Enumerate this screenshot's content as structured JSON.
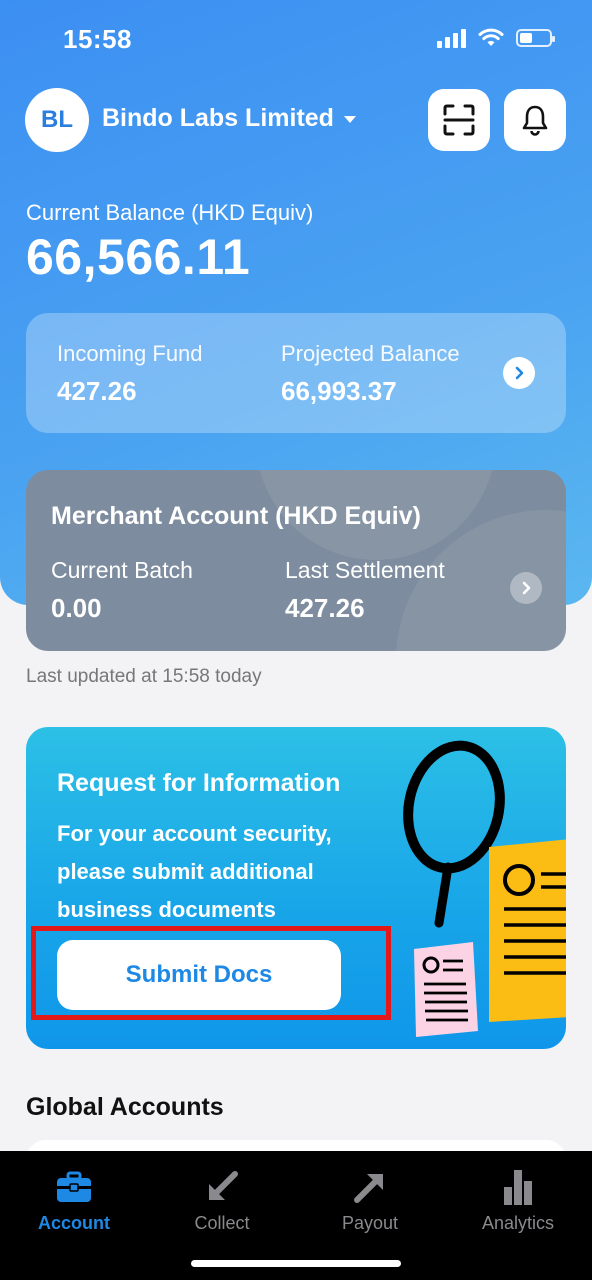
{
  "status_bar": {
    "time": "15:58"
  },
  "header": {
    "avatar_initials": "BL",
    "company_name": "Bindo Labs Limited",
    "icons": [
      "scan-icon",
      "bell-icon"
    ]
  },
  "balance": {
    "label": "Current Balance (HKD Equiv)",
    "value": "66,566.11"
  },
  "fund_card": {
    "incoming_label": "Incoming Fund",
    "incoming_value": "427.26",
    "projected_label": "Projected Balance",
    "projected_value": "66,993.37"
  },
  "merchant": {
    "title": "Merchant Account (HKD Equiv)",
    "batch_label": "Current Batch",
    "batch_value": "0.00",
    "settlement_label": "Last Settlement",
    "settlement_value": "427.26"
  },
  "last_updated": "Last updated at 15:58 today",
  "rfi": {
    "title": "Request for Information",
    "body_line1": "For your account security,",
    "body_line2": "please submit additional",
    "body_line3": "business documents",
    "button": "Submit Docs"
  },
  "global_accounts": {
    "title": "Global Accounts"
  },
  "tabs": [
    {
      "label": "Account",
      "icon": "briefcase-icon",
      "active": true
    },
    {
      "label": "Collect",
      "icon": "arrow-down-left-icon",
      "active": false
    },
    {
      "label": "Payout",
      "icon": "arrow-up-right-icon",
      "active": false
    },
    {
      "label": "Analytics",
      "icon": "bar-chart-icon",
      "active": false
    }
  ],
  "colors": {
    "accent": "#1e88e5",
    "highlight": "#e31919",
    "merchant_card": "#7d8c9e"
  }
}
